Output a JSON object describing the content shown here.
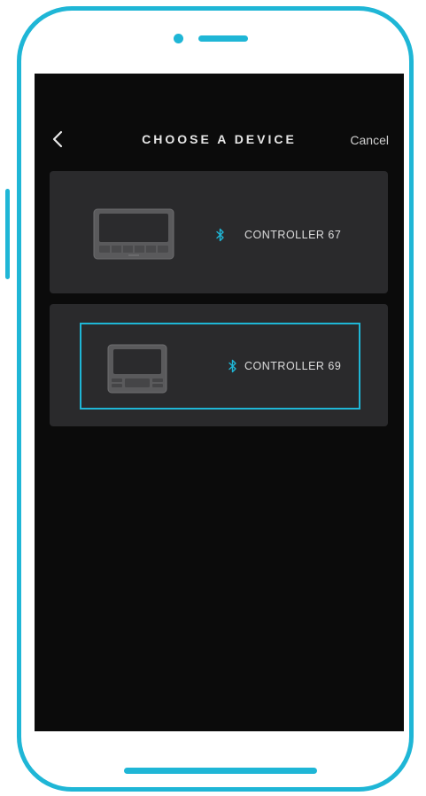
{
  "header": {
    "title": "CHOOSE A DEVICE",
    "cancel_label": "Cancel",
    "back_icon": "chevron-left-icon"
  },
  "devices": [
    {
      "name": "CONTROLLER 67",
      "icon": "bluetooth-icon",
      "selected": false
    },
    {
      "name": "CONTROLLER 69",
      "icon": "bluetooth-icon",
      "selected": true
    }
  ],
  "colors": {
    "accent": "#1fb6d6",
    "screen_bg": "#0b0b0b",
    "card_bg": "#2a2a2c",
    "text": "#dcdcdc"
  }
}
